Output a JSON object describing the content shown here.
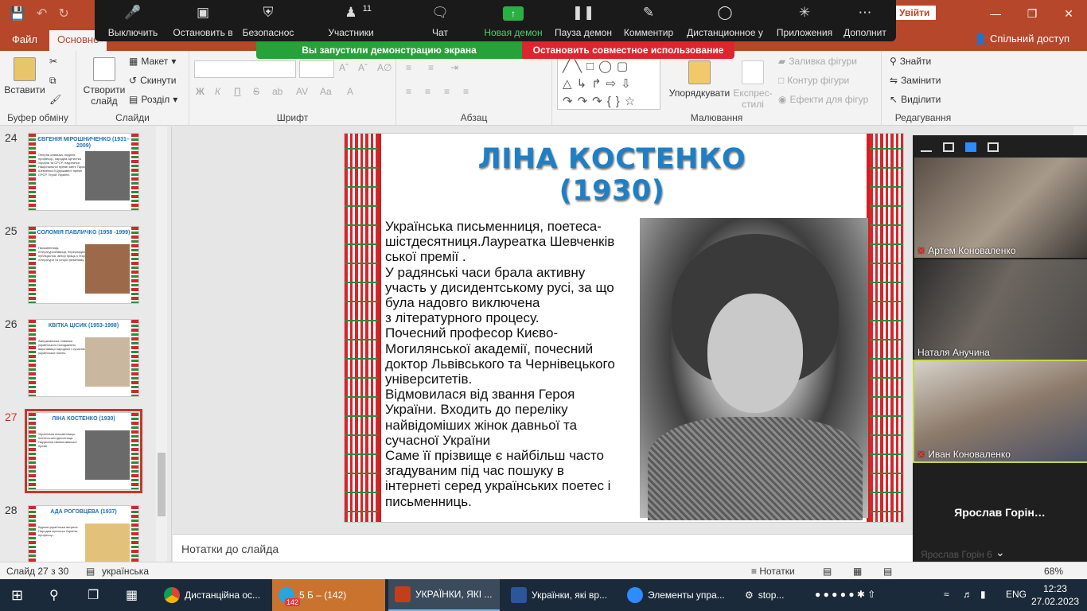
{
  "colors": {
    "accent": "#b7472a",
    "zoom_green": "#25a23a",
    "zoom_red": "#e0242f",
    "title_blue": "#1f7fc4"
  },
  "titlebar": {
    "signin": "Увійти"
  },
  "tabs": {
    "file": "Файл",
    "home": "Основне",
    "share": "Спільний доступ",
    "share_label": "Спільний доступ"
  },
  "ribbon": {
    "paste": "Вставити",
    "clipboard_group": "Буфер обміну",
    "new_slide": "Створити слайд",
    "layout": "Макет",
    "reset": "Скинути",
    "section": "Розділ",
    "slides_group": "Слайди",
    "font_group": "Шрифт",
    "paragraph_group": "Абзац",
    "arrange": "Упорядкувати",
    "quick_styles": "Експрес-стилі",
    "shape_fill": "Заливка фігури",
    "shape_outline": "Контур фігури",
    "shape_effects": "Ефекти для фігур",
    "drawing_group": "Малювання",
    "find": "Знайти",
    "replace": "Замінити",
    "select": "Виділити",
    "editing_group": "Редагування"
  },
  "zoom_toolbar": {
    "mute": "Выключить",
    "stop_video": "Остановить в",
    "security": "Безопаснос",
    "participants": "Участники",
    "participants_count": "11",
    "chat": "Чат",
    "new_share": "Новая демон",
    "pause_share": "Пауза демон",
    "annotate": "Комментир",
    "remote_control": "Дистанционное у",
    "apps": "Приложения",
    "more": "Дополнит",
    "banner": "Вы запустили демонстрацию экрана",
    "stop_share": "Остановить совместное использование"
  },
  "thumbnails": [
    {
      "num": "24",
      "title": "ЄВГЕНІЯ МІРОШНИЧЕНКО (1931–2009)",
      "text": "Оперна співачка, педагог, професор, народна артистка України та СРСР, лауреатка Національної премії імені Тараса Шевченка й Державної премії СРСР, Герой України."
    },
    {
      "num": "25",
      "title": "СОЛОМІЯ ПАВЛИЧКО (1958 -1999)",
      "text": "Письменниця, літературознавиця, перекладач, публіцистка, автор праць з теорії літератури та історії фемінізму."
    },
    {
      "num": "26",
      "title": "КВІТКА ЦІСИК (1953-1998)",
      "text": "Американська співачка українського походження, виконавиця народних і сучасних українських пісень."
    },
    {
      "num": "27",
      "title": "ЛІНА КОСТЕНКО (1930)",
      "text": "Українська письменниця, поетеса-шістдесятниця. Лауреатка Шевченківської премії."
    },
    {
      "num": "28",
      "title": "АДА РОГОВЦЕВА (1937)",
      "text": "Відома українська актриса. Народна артистка України, професор."
    }
  ],
  "slide": {
    "title_line1": "ЛІНА КОСТЕНКО",
    "title_line2": "(1930)",
    "body": "  Українська письменниця, поетеса-\nшістдесятниця.Лауреатка Шевченків\nської премії .\nУ радянські часи брала активну\nучасть у дисидентському русі, за що\nбула надовго виключена\nз літературного процесу.\nПочесний професор Києво-\nМогилянської академії, почесний\nдоктор Львівського та Чернівецького\nуніверситетів.\nВідмовилася від звання Героя\nУкраїни. Входить до переліку\nнайвідоміших жінок давньої та\nсучасної України\n Саме її прізвище є найбільш часто\nзгадуваним під час пошуку в\nінтернеті серед українських поетес і\nписьменниць."
  },
  "notes": {
    "placeholder": "Нотатки до слайда"
  },
  "statusbar": {
    "slide": "Слайд 27 з 30",
    "language": "українська",
    "notes": "Нотатки",
    "zoom": "68%"
  },
  "gallery": {
    "p1": "Артем Коноваленко",
    "p2": "Наталя Анучина",
    "p3": "Иван Коноваленко",
    "p4": "Ярослав  Горін…",
    "p4_small": "Ярослав Горін 6"
  },
  "taskbar": {
    "chrome": "Дистанційна ос...",
    "telegram": "5 Б – (142)",
    "telegram_badge": "142",
    "powerpoint": "УКРАЇНКИ, ЯКІ ...",
    "word": "Українки, які вр...",
    "zoom": "Элементы упра...",
    "stop": "stop...",
    "lang": "ENG",
    "time": "12:23",
    "date": "27.02.2023"
  }
}
